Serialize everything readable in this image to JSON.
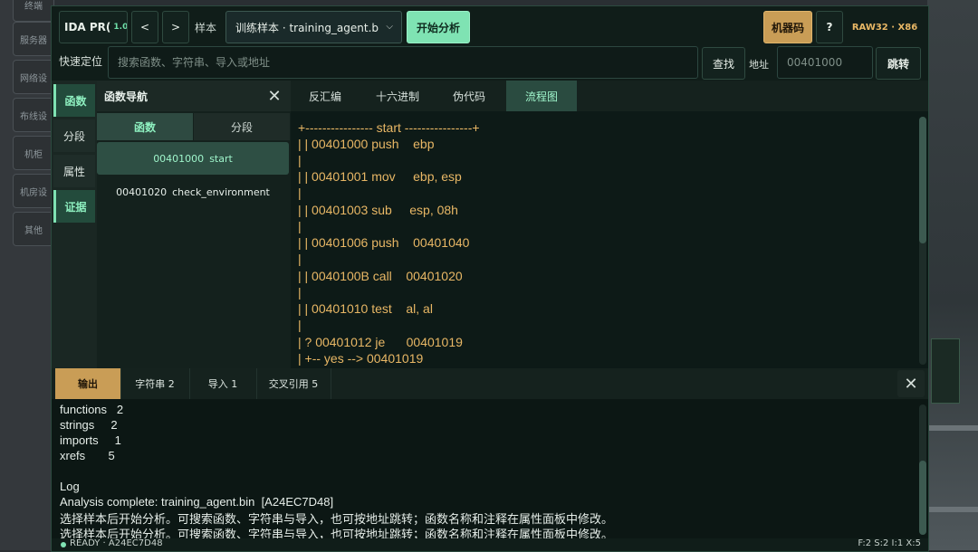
{
  "background": {
    "sidebar_items": [
      "终端",
      "服务器",
      "网络设",
      "布线设",
      "机柜",
      "机房设",
      "其他"
    ]
  },
  "toolbar": {
    "app_name": "IDA PR(",
    "version": "1.0",
    "back_label": "<",
    "forward_label": ">",
    "sample_label": "样本",
    "sample_value": "训练样本 · training_agent.b",
    "start_label": "开始分析",
    "machine_code_label": "机器码",
    "help_label": "?",
    "arch_label": "RAW32 · X86"
  },
  "search": {
    "label": "快速定位",
    "placeholder": "搜索函数、字符串、导入或地址",
    "find_label": "查找",
    "address_label": "地址",
    "address_placeholder": "00401000",
    "jump_label": "跳转"
  },
  "side_tabs": [
    "函数",
    "分段",
    "属性",
    "证据"
  ],
  "function_nav": {
    "title": "函数导航",
    "close": "✕",
    "tabs": [
      "函数",
      "分段"
    ],
    "items": [
      {
        "address": "00401000",
        "name": "start"
      },
      {
        "address": "00401020",
        "name": "check_environment"
      }
    ]
  },
  "code_view": {
    "tabs": [
      "反汇编",
      "十六进制",
      "伪代码",
      "流程图"
    ],
    "lines": [
      "+---------------- start ----------------+",
      "| | 00401000 push    ebp",
      "|",
      "| | 00401001 mov     ebp, esp",
      "|",
      "| | 00401003 sub     esp, 08h",
      "|",
      "| | 00401006 push    00401040",
      "|",
      "| | 0040100B call    00401020",
      "|",
      "| | 00401010 test    al, al",
      "|",
      "| ? 00401012 je      00401019",
      "| +-- yes --> 00401019"
    ]
  },
  "output": {
    "tabs": [
      "输出",
      "字符串 2",
      "导入 1",
      "交叉引用 5"
    ],
    "close": "✕",
    "lines": [
      "functions   2",
      "strings     2",
      "imports     1",
      "xrefs       5",
      "",
      "Log",
      "Analysis complete: training_agent.bin  [A24EC7D48]",
      "选择样本后开始分析。可搜索函数、字符串与导入，也可按地址跳转；函数名称和注释在属性面板中修改。",
      "选择样本后开始分析。可搜索函数、字符串与导入，也可按地址跳转；函数名称和注释在属性面板中修改。"
    ]
  },
  "status": {
    "left": "READY · A24EC7D48",
    "right": "F:2  S:2  I:1  X:5"
  },
  "colors": {
    "accent_green": "#7fe3b3",
    "accent_amber": "#c99d56",
    "code_text": "#e8b765"
  }
}
